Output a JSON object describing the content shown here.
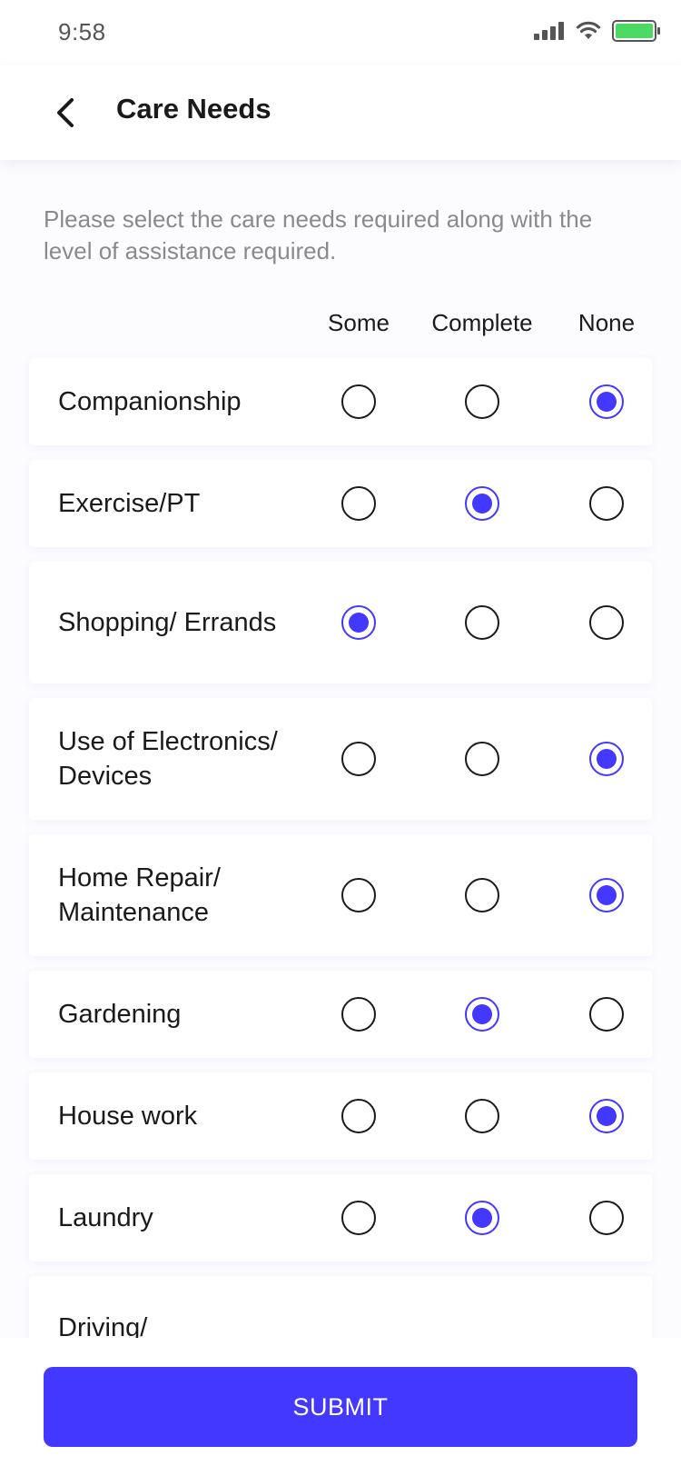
{
  "status_bar": {
    "time": "9:58",
    "battery_color": "#4cd964"
  },
  "header": {
    "title": "Care Needs"
  },
  "instructions": "Please select the care needs required along with the level of assistance required.",
  "columns": [
    "Some",
    "Complete",
    "None"
  ],
  "accent_color": "#4338ff",
  "rows": [
    {
      "label": "Companionship",
      "selected": "None"
    },
    {
      "label": "Exercise/PT",
      "selected": "Complete"
    },
    {
      "label": "Shopping/ Errands",
      "selected": "Some"
    },
    {
      "label": "Use of Electronics/ Devices",
      "selected": "None"
    },
    {
      "label": "Home Repair/ Maintenance",
      "selected": "None"
    },
    {
      "label": "Gardening",
      "selected": "Complete"
    },
    {
      "label": "House work",
      "selected": "None"
    },
    {
      "label": "Laundry",
      "selected": "Complete"
    },
    {
      "label": "Driving/",
      "selected": ""
    }
  ],
  "footer": {
    "submit_label": "SUBMIT"
  }
}
